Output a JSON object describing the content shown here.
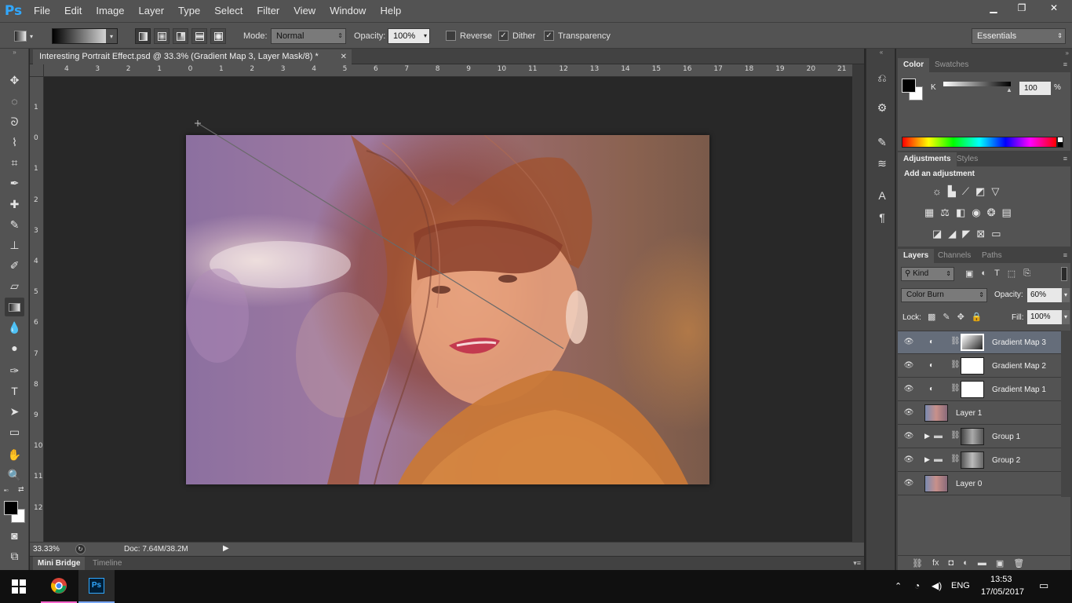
{
  "app": {
    "logo": "Ps"
  },
  "menu": [
    "File",
    "Edit",
    "Image",
    "Layer",
    "Type",
    "Select",
    "Filter",
    "View",
    "Window",
    "Help"
  ],
  "window_controls": {
    "minimize": "▁",
    "restore": "❐",
    "close": "✕"
  },
  "options": {
    "mode_label": "Mode:",
    "mode_value": "Normal",
    "opacity_label": "Opacity:",
    "opacity_value": "100%",
    "reverse_label": "Reverse",
    "reverse_checked": false,
    "dither_label": "Dither",
    "dither_checked": true,
    "transparency_label": "Transparency",
    "transparency_checked": true,
    "workspace": "Essentials"
  },
  "document": {
    "tab_title": "Interesting Portrait Effect.psd @ 33.3% (Gradient Map 3, Layer Mask/8) *",
    "zoom": "33.33%",
    "doc_info": "Doc: 7.64M/38.2M"
  },
  "rulers": {
    "top": [
      "4",
      "3",
      "2",
      "1",
      "0",
      "1",
      "2",
      "3",
      "4",
      "5",
      "6",
      "7",
      "8",
      "9",
      "10",
      "11",
      "12",
      "13",
      "14",
      "15",
      "16",
      "17",
      "18",
      "19",
      "20",
      "21"
    ],
    "left": [
      "1",
      "0",
      "1",
      "2",
      "3",
      "4",
      "5",
      "6",
      "7",
      "8",
      "9",
      "10",
      "11",
      "12"
    ]
  },
  "bottom_tabs": [
    "Mini Bridge",
    "Timeline"
  ],
  "color_panel": {
    "tabs": [
      "Color",
      "Swatches"
    ],
    "channel": "K",
    "value": "100",
    "unit": "%"
  },
  "adjustments_panel": {
    "tabs": [
      "Adjustments",
      "Styles"
    ],
    "heading": "Add an adjustment"
  },
  "layers_panel": {
    "tabs": [
      "Layers",
      "Channels",
      "Paths"
    ],
    "filter_kind": "Kind",
    "blend_mode": "Color Burn",
    "opacity_label": "Opacity:",
    "opacity_value": "60%",
    "lock_label": "Lock:",
    "fill_label": "Fill:",
    "fill_value": "100%",
    "layers": [
      {
        "name": "Gradient Map 3",
        "kind": "adjustment",
        "selected": true
      },
      {
        "name": "Gradient Map 2",
        "kind": "adjustment",
        "selected": false
      },
      {
        "name": "Gradient Map 1",
        "kind": "adjustment",
        "selected": false
      },
      {
        "name": "Layer 1",
        "kind": "pixel",
        "selected": false
      },
      {
        "name": "Group 1",
        "kind": "group",
        "selected": false
      },
      {
        "name": "Group 2",
        "kind": "group",
        "selected": false
      },
      {
        "name": "Layer 0",
        "kind": "pixel",
        "selected": false
      }
    ]
  },
  "taskbar": {
    "language": "ENG",
    "time": "13:53",
    "date": "17/05/2017"
  },
  "colors": {
    "ui_dark": "#535353",
    "ui_darker": "#424242",
    "canvas_bg": "#282828",
    "selection": "#656d7a",
    "ps_blue": "#31a8ff"
  }
}
